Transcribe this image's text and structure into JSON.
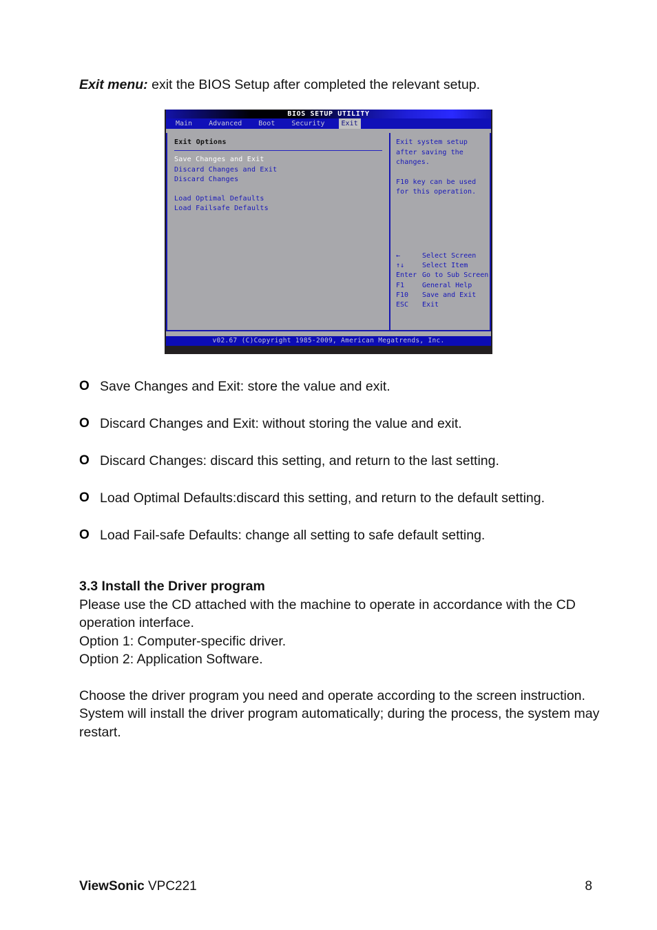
{
  "intro": {
    "lead": "Exit menu:",
    "rest": " exit the BIOS Setup after completed the relevant setup."
  },
  "bios": {
    "title": "BIOS SETUP UTILITY",
    "menu": [
      {
        "label": "Main",
        "active": false
      },
      {
        "label": "Advanced",
        "active": false
      },
      {
        "label": "Boot",
        "active": false
      },
      {
        "label": "Security",
        "active": false
      },
      {
        "label": "Exit",
        "active": true
      }
    ],
    "section_title": "Exit Options",
    "options": [
      {
        "label": "Save Changes and Exit",
        "selected": true
      },
      {
        "label": "Discard Changes and Exit",
        "selected": false
      },
      {
        "label": "Discard Changes",
        "selected": false
      },
      {
        "label": "Load Optimal Defaults",
        "selected": false
      },
      {
        "label": "Load Failsafe Defaults",
        "selected": false
      }
    ],
    "help": {
      "line1": "Exit system setup",
      "line2": "after saving the",
      "line3": "changes.",
      "line4": "F10 key can be used",
      "line5": "for this operation."
    },
    "legend": [
      {
        "key": "←",
        "action": "Select Screen"
      },
      {
        "key": "↑↓",
        "action": "Select Item"
      },
      {
        "key": "Enter",
        "action": "Go to Sub Screen"
      },
      {
        "key": "F1",
        "action": "General Help"
      },
      {
        "key": "F10",
        "action": "Save and Exit"
      },
      {
        "key": "ESC",
        "action": "Exit"
      }
    ],
    "footer": "v02.67 (C)Copyright 1985-2009, American Megatrends, Inc.",
    "colors": {
      "menubar": "#1010b8",
      "panel": "#a8a8ac",
      "text": "#1818b8",
      "selected_text": "#ffffff",
      "footer_bar": "#0c0cb4",
      "border": "#1515b0"
    }
  },
  "bullets": [
    {
      "mark": "O",
      "text": "Save Changes and Exit: store the value and exit."
    },
    {
      "mark": "O",
      "text": "Discard Changes and Exit: without storing the value and exit."
    },
    {
      "mark": "O",
      "text": "Discard Changes: discard this setting, and return to the last setting."
    },
    {
      "mark": "O",
      "text": "Load Optimal Defaults:discard this setting, and return to the default setting."
    },
    {
      "mark": "O",
      "text": "Load Fail-safe Defaults: change all setting to safe default setting."
    }
  ],
  "section33": {
    "heading": "3.3 Install the Driver program",
    "para1": "Please use the CD attached with the machine to operate in accordance with the CD operation interface.",
    "option1": "Option 1: Computer-specific driver.",
    "option2": "Option 2: Application Software.",
    "para2": "Choose the driver program you need and operate according to the screen instruction. System will install the driver program automatically; during the process, the system may restart."
  },
  "page_footer": {
    "brand": "ViewSonic",
    "model": "VPC221",
    "page_number": "8"
  }
}
